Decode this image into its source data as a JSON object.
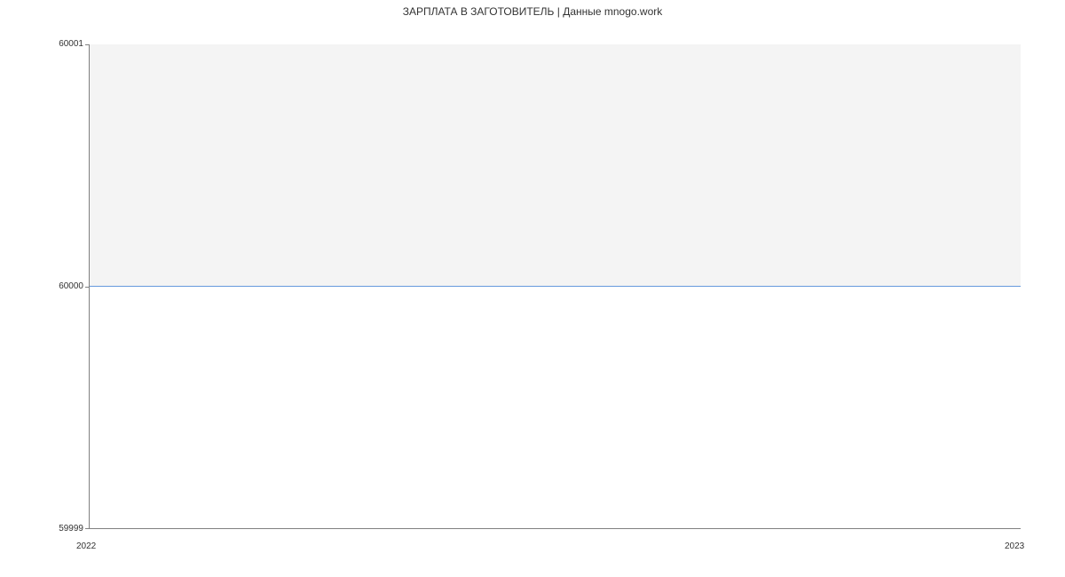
{
  "chart_data": {
    "type": "line",
    "title": "ЗАРПЛАТА В  ЗАГОТОВИТЕЛЬ | Данные mnogo.work",
    "xlabel": "",
    "ylabel": "",
    "x": [
      "2022",
      "2023"
    ],
    "values": [
      60000,
      60000
    ],
    "ylim": [
      59999,
      60001
    ],
    "y_ticks": [
      59999,
      60000,
      60001
    ],
    "x_ticks": [
      "2022",
      "2023"
    ]
  },
  "labels": {
    "y_top": "60001",
    "y_mid": "60000",
    "y_bot": "59999",
    "x_left": "2022",
    "x_right": "2023"
  }
}
